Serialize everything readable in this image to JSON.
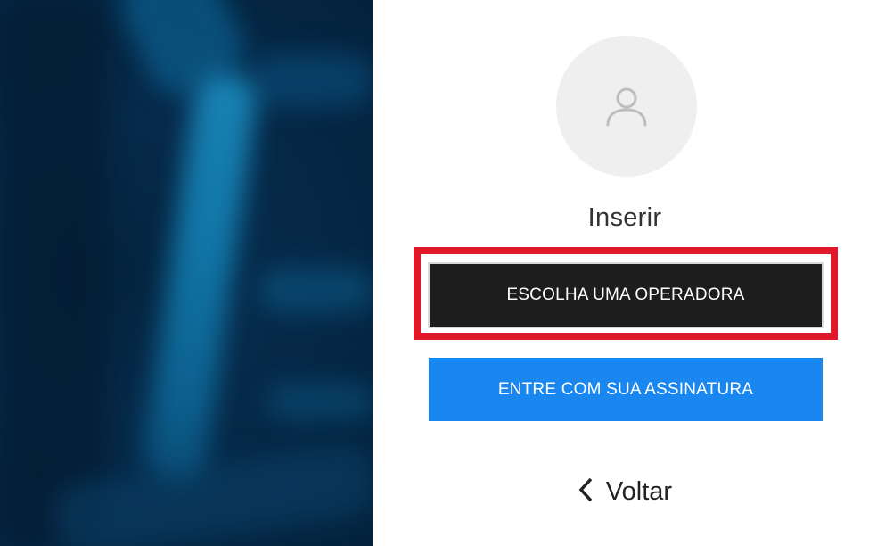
{
  "login": {
    "title": "Inserir",
    "avatar_icon": "user-icon",
    "operator_button_label": "ESCOLHA UMA OPERADORA",
    "subscription_button_label": "ENTRE COM SUA ASSINATURA",
    "back_label": "Voltar",
    "back_icon": "chevron-left-icon"
  },
  "colors": {
    "operator_button_bg": "#1e1d1d",
    "subscription_button_bg": "#1a86f0",
    "highlight_border": "#e0182a",
    "background_panel": "#062a4a"
  }
}
